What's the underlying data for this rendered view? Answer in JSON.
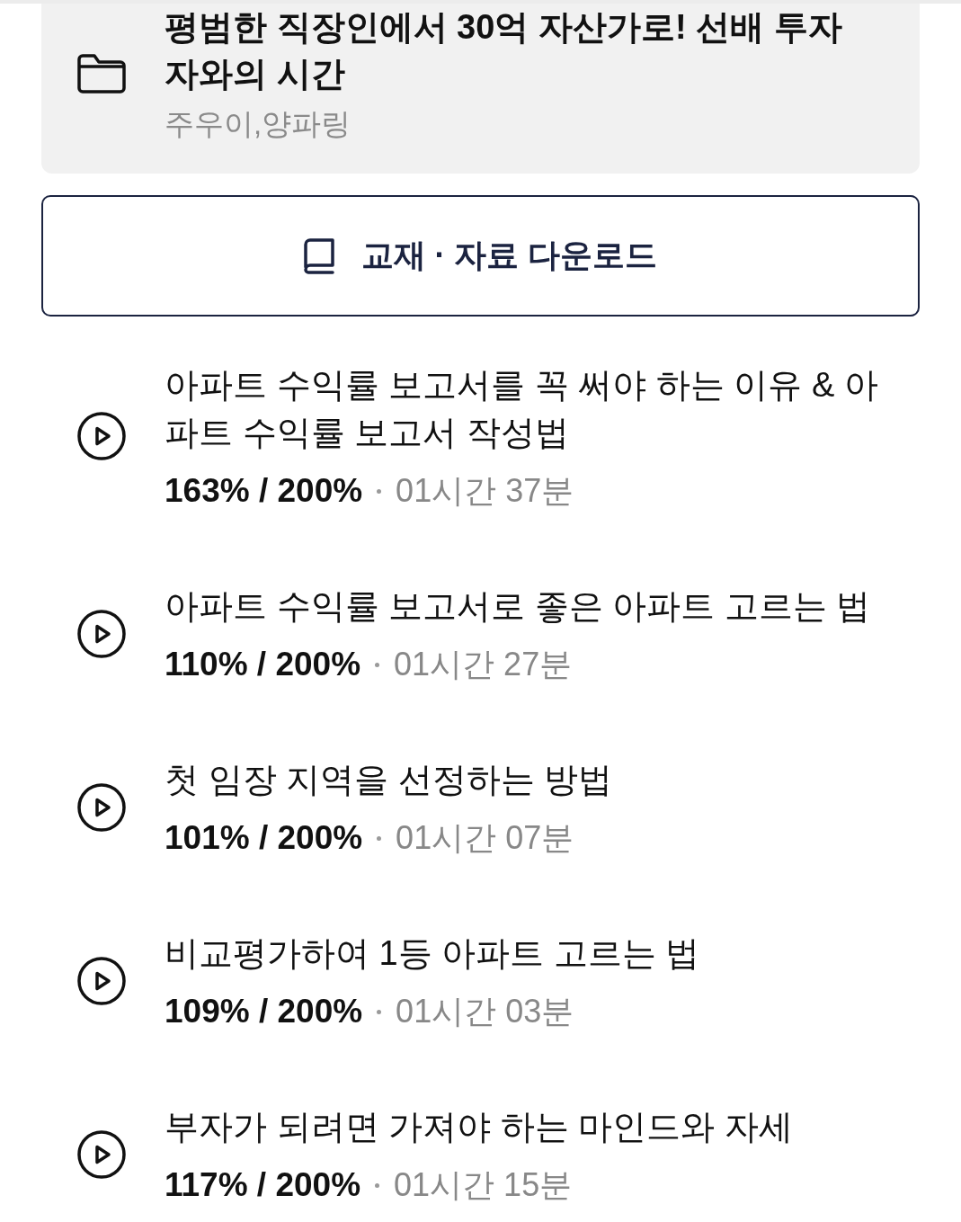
{
  "course": {
    "title": "평범한 직장인에서 30억 자산가로! 선배 투자자와의 시간",
    "instructors": "주우이,양파링"
  },
  "download_button": {
    "label": "교재 · 자료 다운로드"
  },
  "lessons": [
    {
      "title": "아파트 수익률 보고서를 꼭 써야 하는 이유 & 아파트 수익률 보고서 작성법",
      "progress": "163% / 200%",
      "duration": "01시간 37분"
    },
    {
      "title": "아파트 수익률 보고서로 좋은 아파트 고르는 법",
      "progress": "110% / 200%",
      "duration": "01시간 27분"
    },
    {
      "title": "첫 임장 지역을 선정하는 방법",
      "progress": "101% / 200%",
      "duration": "01시간 07분"
    },
    {
      "title": "비교평가하여 1등 아파트 고르는 법",
      "progress": "109% / 200%",
      "duration": "01시간 03분"
    },
    {
      "title": "부자가 되려면 가져야 하는 마인드와 자세",
      "progress": "117% / 200%",
      "duration": "01시간 15분"
    }
  ]
}
